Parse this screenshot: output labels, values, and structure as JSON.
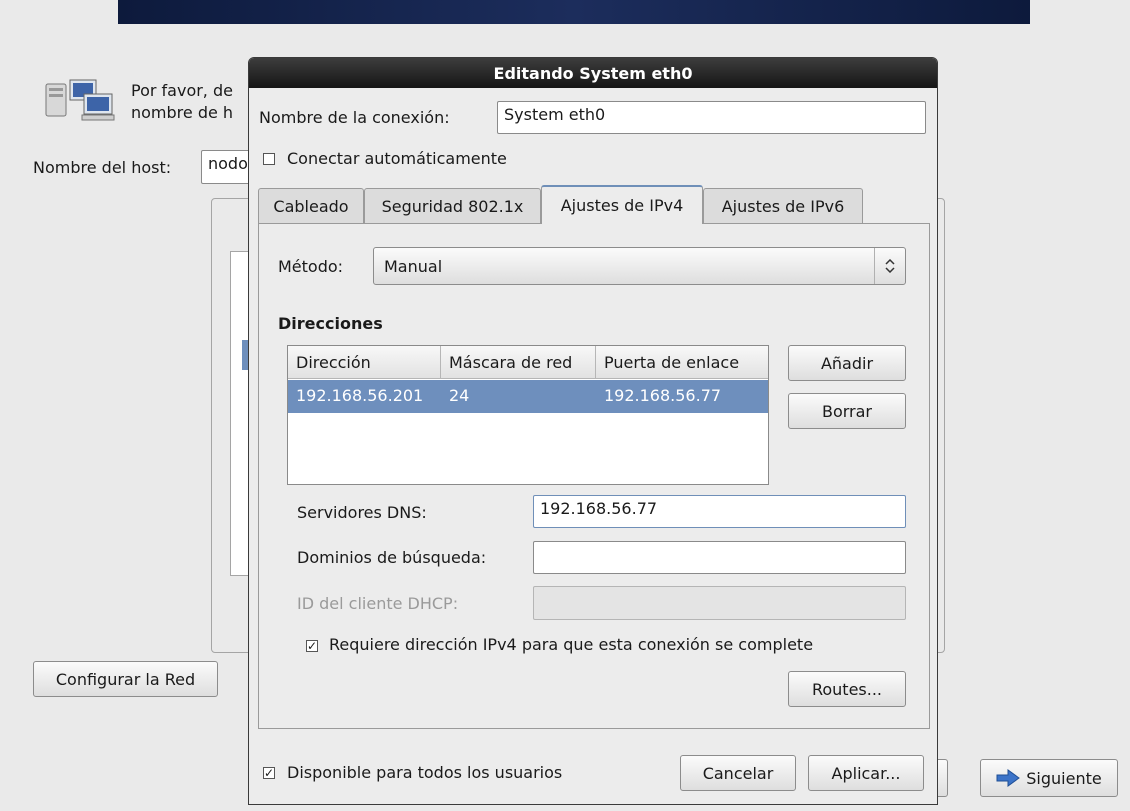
{
  "background": {
    "intro_line1": "Por favor, de",
    "intro_line2": "nombre de h",
    "hostname_label": "Nombre del host:",
    "hostname_value": "nodo",
    "configure_network_button": "Configurar la Red",
    "next_button": "Siguiente"
  },
  "dialog": {
    "title": "Editando System eth0",
    "connection_name_label": "Nombre de la conexión:",
    "connection_name_value": "System eth0",
    "auto_connect_label": "Conectar automáticamente",
    "auto_connect_checked": false,
    "tabs": [
      {
        "label": "Cableado",
        "active": false
      },
      {
        "label": "Seguridad 802.1x",
        "active": false
      },
      {
        "label": "Ajustes de IPv4",
        "active": true
      },
      {
        "label": "Ajustes de IPv6",
        "active": false
      }
    ],
    "method_label": "Método:",
    "method_value": "Manual",
    "addresses_heading": "Direcciones",
    "addresses_columns": [
      "Dirección",
      "Máscara de red",
      "Puerta de enlace"
    ],
    "addresses_rows": [
      {
        "address": "192.168.56.201",
        "netmask": "24",
        "gateway": "192.168.56.77"
      }
    ],
    "add_button": "Añadir",
    "delete_button": "Borrar",
    "dns_label": "Servidores DNS:",
    "dns_value": "192.168.56.77",
    "search_domains_label": "Dominios de búsqueda:",
    "search_domains_value": "",
    "dhcp_client_id_label": "ID del cliente DHCP:",
    "dhcp_client_id_value": "",
    "require_ipv4_label": "Requiere dirección IPv4 para que esta conexión se complete",
    "require_ipv4_checked": true,
    "routes_button": "Routes...",
    "available_all_users_label": "Disponible para todos los usuarios",
    "available_all_users_checked": true,
    "cancel_button": "Cancelar",
    "apply_button": "Aplicar..."
  },
  "colors": {
    "title_bar": "#1f1f1f",
    "selection": "#6e8fbd",
    "banner": "#1c2d5c"
  }
}
